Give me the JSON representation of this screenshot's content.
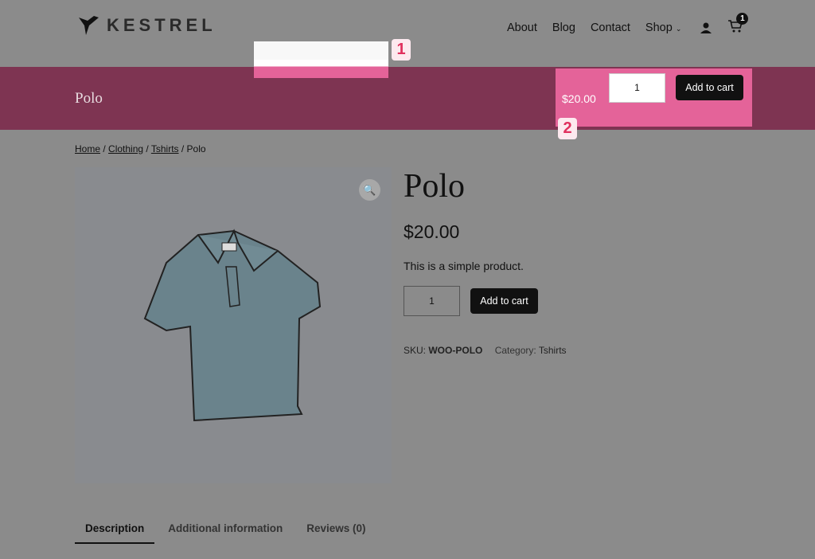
{
  "header": {
    "logo": "KESTREL",
    "nav": [
      "About",
      "Blog",
      "Contact",
      "Shop"
    ],
    "cart_count": "1"
  },
  "band": {
    "title": "Polo"
  },
  "annotations": [
    "1",
    "2"
  ],
  "sticky": {
    "price": "$20.00",
    "qty": "1",
    "add_label": "Add to cart"
  },
  "breadcrumb": [
    "Home",
    "Clothing",
    "Tshirts",
    "Polo"
  ],
  "product": {
    "title": "Polo",
    "price": "$20.00",
    "description": "This is a simple product.",
    "qty": "1",
    "add_label": "Add to cart",
    "sku_label": "SKU:",
    "sku": "WOO-POLO",
    "category_label": "Category:",
    "category": "Tshirts"
  },
  "tabs": [
    "Description",
    "Additional information",
    "Reviews (0)"
  ],
  "colors": {
    "band": "#7e3452",
    "highlight": "#e46399",
    "button": "#111111"
  }
}
